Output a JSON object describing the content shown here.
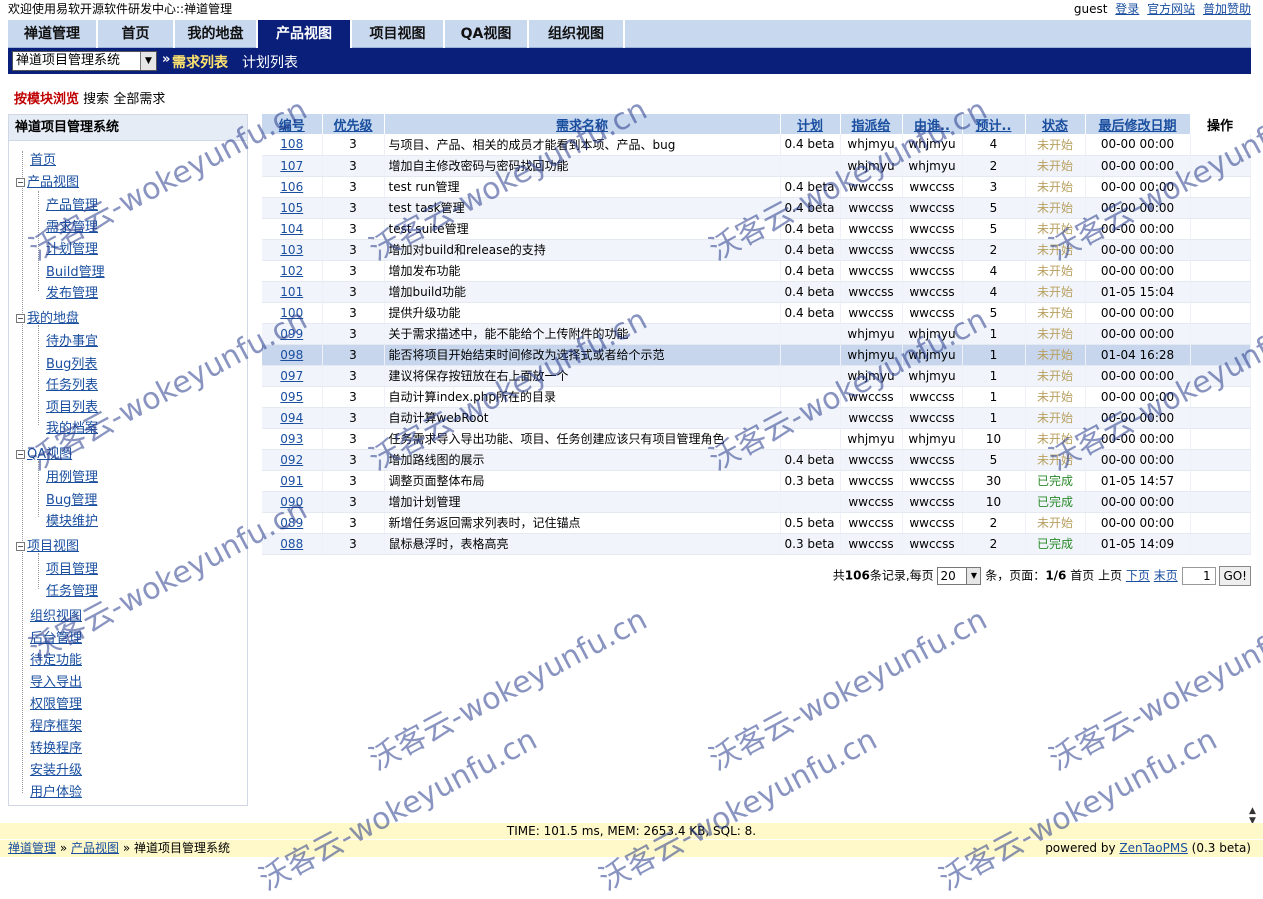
{
  "header": {
    "title": "欢迎使用易软开源软件研发中心::禅道管理",
    "user": "guest",
    "links": [
      "登录",
      "官方网站",
      "普加赞助"
    ]
  },
  "nav": {
    "tabs": [
      "禅道管理",
      "首页",
      "我的地盘",
      "产品视图",
      "项目视图",
      "QA视图",
      "组织视图"
    ],
    "active": "产品视图"
  },
  "subnav": {
    "product": "禅道项目管理系统",
    "separator": "»",
    "current": "需求列表",
    "other": "计划列表"
  },
  "browse": {
    "module_browse": "按模块浏览",
    "search": "搜索",
    "all": "全部需求"
  },
  "sidebar": {
    "title": "禅道项目管理系统",
    "items": [
      "首页",
      "产品视图",
      "产品管理",
      "需求管理",
      "计划管理",
      "Build管理",
      "发布管理",
      "我的地盘",
      "待办事宜",
      "Bug列表",
      "任务列表",
      "项目列表",
      "我的档案",
      "QA视图",
      "用例管理",
      "Bug管理",
      "模块维护",
      "项目视图",
      "项目管理",
      "任务管理",
      "组织视图",
      "后台管理",
      "待定功能",
      "导入导出",
      "权限管理",
      "程序框架",
      "转换程序",
      "安装升级",
      "用户体验"
    ]
  },
  "table": {
    "headers": [
      "编号",
      "优先级",
      "需求名称",
      "计划",
      "指派给",
      "由谁..",
      "预计..",
      "状态",
      "最后修改日期",
      "操作"
    ],
    "rows": [
      [
        "108",
        "3",
        "与项目、产品、相关的成员才能看到本项、产品、bug",
        "0.4 beta",
        "whjmyu",
        "whjmyu",
        "4",
        "未开始",
        "00-00 00:00"
      ],
      [
        "107",
        "3",
        "增加自主修改密码与密码找回功能",
        "",
        "whjmyu",
        "whjmyu",
        "2",
        "未开始",
        "00-00 00:00"
      ],
      [
        "106",
        "3",
        "test run管理",
        "0.4 beta",
        "wwccss",
        "wwccss",
        "3",
        "未开始",
        "00-00 00:00"
      ],
      [
        "105",
        "3",
        "test task管理",
        "0.4 beta",
        "wwccss",
        "wwccss",
        "5",
        "未开始",
        "00-00 00:00"
      ],
      [
        "104",
        "3",
        "test suite管理",
        "0.4 beta",
        "wwccss",
        "wwccss",
        "5",
        "未开始",
        "00-00 00:00"
      ],
      [
        "103",
        "3",
        "增加对build和release的支持",
        "0.4 beta",
        "wwccss",
        "wwccss",
        "2",
        "未开始",
        "00-00 00:00"
      ],
      [
        "102",
        "3",
        "增加发布功能",
        "0.4 beta",
        "wwccss",
        "wwccss",
        "4",
        "未开始",
        "00-00 00:00"
      ],
      [
        "101",
        "3",
        "增加build功能",
        "0.4 beta",
        "wwccss",
        "wwccss",
        "4",
        "未开始",
        "01-05 15:04"
      ],
      [
        "100",
        "3",
        "提供升级功能",
        "0.4 beta",
        "wwccss",
        "wwccss",
        "5",
        "未开始",
        "00-00 00:00"
      ],
      [
        "099",
        "3",
        "关于需求描述中，能不能给个上传附件的功能",
        "",
        "whjmyu",
        "whjmyu",
        "1",
        "未开始",
        "00-00 00:00"
      ],
      [
        "098",
        "3",
        "能否将项目开始结束时间修改为选择式或者给个示范",
        "",
        "whjmyu",
        "whjmyu",
        "1",
        "未开始",
        "01-04 16:28"
      ],
      [
        "097",
        "3",
        "建议将保存按钮放在右上面放一个",
        "",
        "whjmyu",
        "whjmyu",
        "1",
        "未开始",
        "00-00 00:00"
      ],
      [
        "095",
        "3",
        "自动计算index.php所在的目录",
        "",
        "wwccss",
        "wwccss",
        "1",
        "未开始",
        "00-00 00:00"
      ],
      [
        "094",
        "3",
        "自动计算webRoot",
        "",
        "wwccss",
        "wwccss",
        "1",
        "未开始",
        "00-00 00:00"
      ],
      [
        "093",
        "3",
        "任务需求导入导出功能、项目、任务创建应该只有项目管理角色",
        "",
        "whjmyu",
        "whjmyu",
        "10",
        "未开始",
        "00-00 00:00"
      ],
      [
        "092",
        "3",
        "增加路线图的展示",
        "0.4 beta",
        "wwccss",
        "wwccss",
        "5",
        "未开始",
        "00-00 00:00"
      ],
      [
        "091",
        "3",
        "调整页面整体布局",
        "0.3 beta",
        "wwccss",
        "wwccss",
        "30",
        "已完成",
        "01-05 14:57"
      ],
      [
        "090",
        "3",
        "增加计划管理",
        "",
        "wwccss",
        "wwccss",
        "10",
        "已完成",
        "00-00 00:00"
      ],
      [
        "089",
        "3",
        "新增任务返回需求列表时，记住锚点",
        "0.5 beta",
        "wwccss",
        "wwccss",
        "2",
        "未开始",
        "00-00 00:00"
      ],
      [
        "088",
        "3",
        "鼠标悬浮时，表格高亮",
        "0.3 beta",
        "wwccss",
        "wwccss",
        "2",
        "已完成",
        "01-05 14:09"
      ]
    ],
    "selected_id": "098"
  },
  "pager": {
    "prefix": "共",
    "total": "106",
    "mid": "条记录,每页",
    "per_page": "20",
    "unit": "条，页面：",
    "page_info": "1/6",
    "first": "首页",
    "prev": "上页",
    "next": "下页",
    "last": "末页",
    "page_value": "1",
    "go": "GO!"
  },
  "footer": {
    "stats": "TIME: 101.5 ms, MEM: 2653.4 KB, SQL: 8.",
    "crumbs": [
      "禅道管理",
      "产品视图",
      "禅道项目管理系统"
    ],
    "crumb_sep": "»",
    "powered_prefix": "powered by",
    "powered_link": "ZenTaoPMS",
    "powered_version": "(0.3 beta)"
  },
  "watermark": "沃客云-wokeyunfu.cn",
  "colors": {
    "nav_bg": "#c8d8ee",
    "nav_active": "#0a1f7a",
    "status_todo": "#b8a060",
    "status_done": "#2a8a2a",
    "footer_bg": "#fff8c8"
  }
}
